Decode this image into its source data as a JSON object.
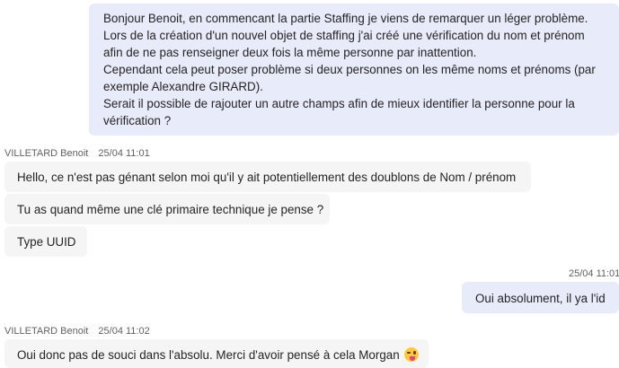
{
  "messages": {
    "m1": {
      "lines": [
        "Bonjour Benoit, en commencant la partie Staffing je viens de remarquer un léger problème. Lors de la création d'un nouvel objet de staffing j'ai créé une vérification du nom et prénom afin de ne pas renseigner deux fois la même personne par inattention.",
        "Cependant cela peut poser problème si deux personnes on les même noms et prénoms (par exemple Alexandre GIRARD).",
        "Serait il possible de rajouter un autre champs afin de mieux identifier la personne pour la vérification ?"
      ]
    },
    "m2": {
      "sender": "VILLETARD Benoit",
      "time": "25/04 11:01",
      "bubbles": [
        "Hello, ce n'est pas génant selon moi qu'il y ait potentiellement des doublons de Nom / prénom",
        "Tu as quand même une clé primaire technique je pense ?",
        "Type UUID"
      ]
    },
    "m3": {
      "time": "25/04 11:01",
      "text": "Oui absolument, il ya l'id"
    },
    "m4": {
      "sender": "VILLETARD Benoit",
      "time": "25/04 11:02",
      "text": "Oui donc pas de souci dans l'absolu. Merci d'avoir pensé à cela Morgan",
      "emoji": "winking-face-with-tongue-icon"
    }
  }
}
